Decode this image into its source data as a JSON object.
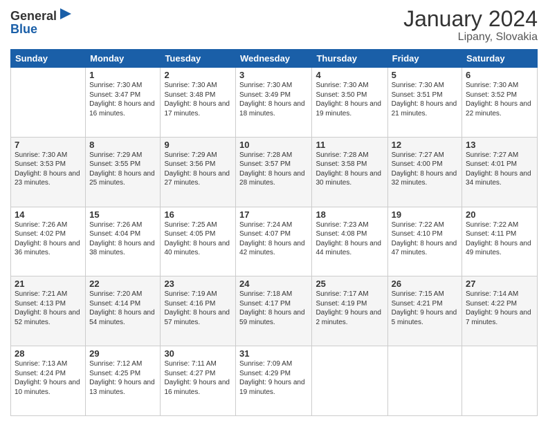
{
  "logo": {
    "general": "General",
    "blue": "Blue"
  },
  "title": "January 2024",
  "subtitle": "Lipany, Slovakia",
  "days_header": [
    "Sunday",
    "Monday",
    "Tuesday",
    "Wednesday",
    "Thursday",
    "Friday",
    "Saturday"
  ],
  "weeks": [
    [
      {
        "day": "",
        "sunrise": "",
        "sunset": "",
        "daylight": ""
      },
      {
        "day": "1",
        "sunrise": "7:30 AM",
        "sunset": "3:47 PM",
        "daylight": "8 hours and 16 minutes."
      },
      {
        "day": "2",
        "sunrise": "7:30 AM",
        "sunset": "3:48 PM",
        "daylight": "8 hours and 17 minutes."
      },
      {
        "day": "3",
        "sunrise": "7:30 AM",
        "sunset": "3:49 PM",
        "daylight": "8 hours and 18 minutes."
      },
      {
        "day": "4",
        "sunrise": "7:30 AM",
        "sunset": "3:50 PM",
        "daylight": "8 hours and 19 minutes."
      },
      {
        "day": "5",
        "sunrise": "7:30 AM",
        "sunset": "3:51 PM",
        "daylight": "8 hours and 21 minutes."
      },
      {
        "day": "6",
        "sunrise": "7:30 AM",
        "sunset": "3:52 PM",
        "daylight": "8 hours and 22 minutes."
      }
    ],
    [
      {
        "day": "7",
        "sunrise": "7:30 AM",
        "sunset": "3:53 PM",
        "daylight": "8 hours and 23 minutes."
      },
      {
        "day": "8",
        "sunrise": "7:29 AM",
        "sunset": "3:55 PM",
        "daylight": "8 hours and 25 minutes."
      },
      {
        "day": "9",
        "sunrise": "7:29 AM",
        "sunset": "3:56 PM",
        "daylight": "8 hours and 27 minutes."
      },
      {
        "day": "10",
        "sunrise": "7:28 AM",
        "sunset": "3:57 PM",
        "daylight": "8 hours and 28 minutes."
      },
      {
        "day": "11",
        "sunrise": "7:28 AM",
        "sunset": "3:58 PM",
        "daylight": "8 hours and 30 minutes."
      },
      {
        "day": "12",
        "sunrise": "7:27 AM",
        "sunset": "4:00 PM",
        "daylight": "8 hours and 32 minutes."
      },
      {
        "day": "13",
        "sunrise": "7:27 AM",
        "sunset": "4:01 PM",
        "daylight": "8 hours and 34 minutes."
      }
    ],
    [
      {
        "day": "14",
        "sunrise": "7:26 AM",
        "sunset": "4:02 PM",
        "daylight": "8 hours and 36 minutes."
      },
      {
        "day": "15",
        "sunrise": "7:26 AM",
        "sunset": "4:04 PM",
        "daylight": "8 hours and 38 minutes."
      },
      {
        "day": "16",
        "sunrise": "7:25 AM",
        "sunset": "4:05 PM",
        "daylight": "8 hours and 40 minutes."
      },
      {
        "day": "17",
        "sunrise": "7:24 AM",
        "sunset": "4:07 PM",
        "daylight": "8 hours and 42 minutes."
      },
      {
        "day": "18",
        "sunrise": "7:23 AM",
        "sunset": "4:08 PM",
        "daylight": "8 hours and 44 minutes."
      },
      {
        "day": "19",
        "sunrise": "7:22 AM",
        "sunset": "4:10 PM",
        "daylight": "8 hours and 47 minutes."
      },
      {
        "day": "20",
        "sunrise": "7:22 AM",
        "sunset": "4:11 PM",
        "daylight": "8 hours and 49 minutes."
      }
    ],
    [
      {
        "day": "21",
        "sunrise": "7:21 AM",
        "sunset": "4:13 PM",
        "daylight": "8 hours and 52 minutes."
      },
      {
        "day": "22",
        "sunrise": "7:20 AM",
        "sunset": "4:14 PM",
        "daylight": "8 hours and 54 minutes."
      },
      {
        "day": "23",
        "sunrise": "7:19 AM",
        "sunset": "4:16 PM",
        "daylight": "8 hours and 57 minutes."
      },
      {
        "day": "24",
        "sunrise": "7:18 AM",
        "sunset": "4:17 PM",
        "daylight": "8 hours and 59 minutes."
      },
      {
        "day": "25",
        "sunrise": "7:17 AM",
        "sunset": "4:19 PM",
        "daylight": "9 hours and 2 minutes."
      },
      {
        "day": "26",
        "sunrise": "7:15 AM",
        "sunset": "4:21 PM",
        "daylight": "9 hours and 5 minutes."
      },
      {
        "day": "27",
        "sunrise": "7:14 AM",
        "sunset": "4:22 PM",
        "daylight": "9 hours and 7 minutes."
      }
    ],
    [
      {
        "day": "28",
        "sunrise": "7:13 AM",
        "sunset": "4:24 PM",
        "daylight": "9 hours and 10 minutes."
      },
      {
        "day": "29",
        "sunrise": "7:12 AM",
        "sunset": "4:25 PM",
        "daylight": "9 hours and 13 minutes."
      },
      {
        "day": "30",
        "sunrise": "7:11 AM",
        "sunset": "4:27 PM",
        "daylight": "9 hours and 16 minutes."
      },
      {
        "day": "31",
        "sunrise": "7:09 AM",
        "sunset": "4:29 PM",
        "daylight": "9 hours and 19 minutes."
      },
      {
        "day": "",
        "sunrise": "",
        "sunset": "",
        "daylight": ""
      },
      {
        "day": "",
        "sunrise": "",
        "sunset": "",
        "daylight": ""
      },
      {
        "day": "",
        "sunrise": "",
        "sunset": "",
        "daylight": ""
      }
    ]
  ]
}
